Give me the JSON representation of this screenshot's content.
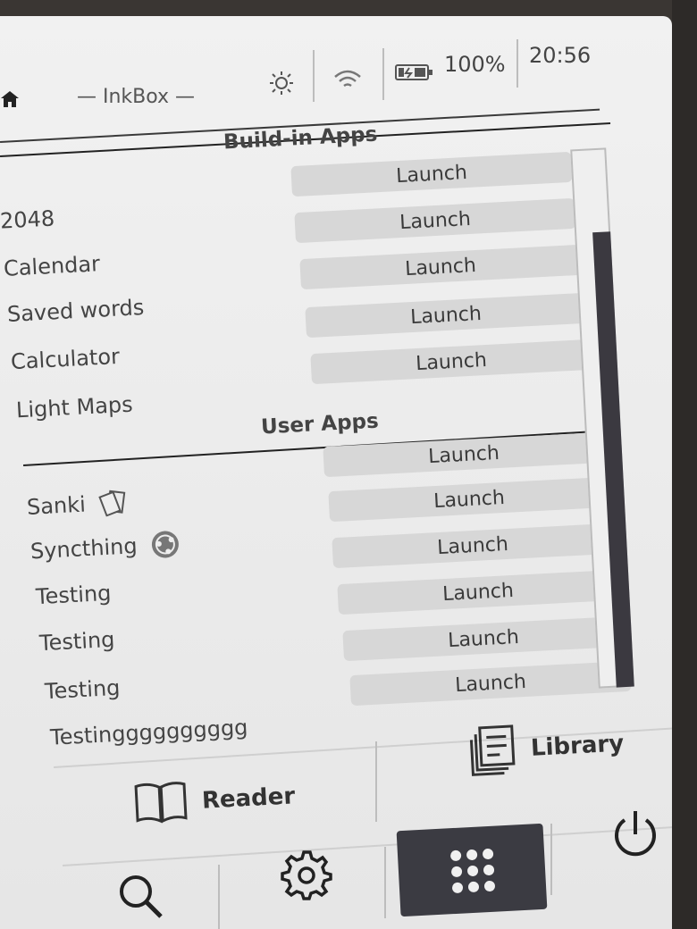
{
  "status_bar": {
    "title": "— InkBox —",
    "battery": "100%",
    "time": "20:56"
  },
  "builtin_apps": {
    "header": "Build-in Apps",
    "items": [
      {
        "label": "",
        "action": "Launch"
      },
      {
        "label": "2048",
        "action": "Launch"
      },
      {
        "label": "Calendar",
        "action": "Launch"
      },
      {
        "label": "Saved words",
        "action": "Launch"
      },
      {
        "label": "Calculator",
        "action": "Launch"
      },
      {
        "label": "Light Maps",
        "action": ""
      }
    ]
  },
  "user_apps": {
    "header": "User Apps",
    "items": [
      {
        "label": "",
        "action": "Launch"
      },
      {
        "label": "Sanki",
        "action": "Launch",
        "icon": "cards-icon"
      },
      {
        "label": "Syncthing",
        "action": "Launch",
        "icon": "syncthing-icon"
      },
      {
        "label": "Testing",
        "action": "Launch"
      },
      {
        "label": "Testing",
        "action": "Launch"
      },
      {
        "label": "Testing",
        "action": "Launch"
      },
      {
        "label": "Testingggggggggg",
        "action": ""
      }
    ]
  },
  "nav": {
    "reader": "Reader",
    "library": "Library"
  },
  "bottom_bar": {
    "active": "apps"
  }
}
